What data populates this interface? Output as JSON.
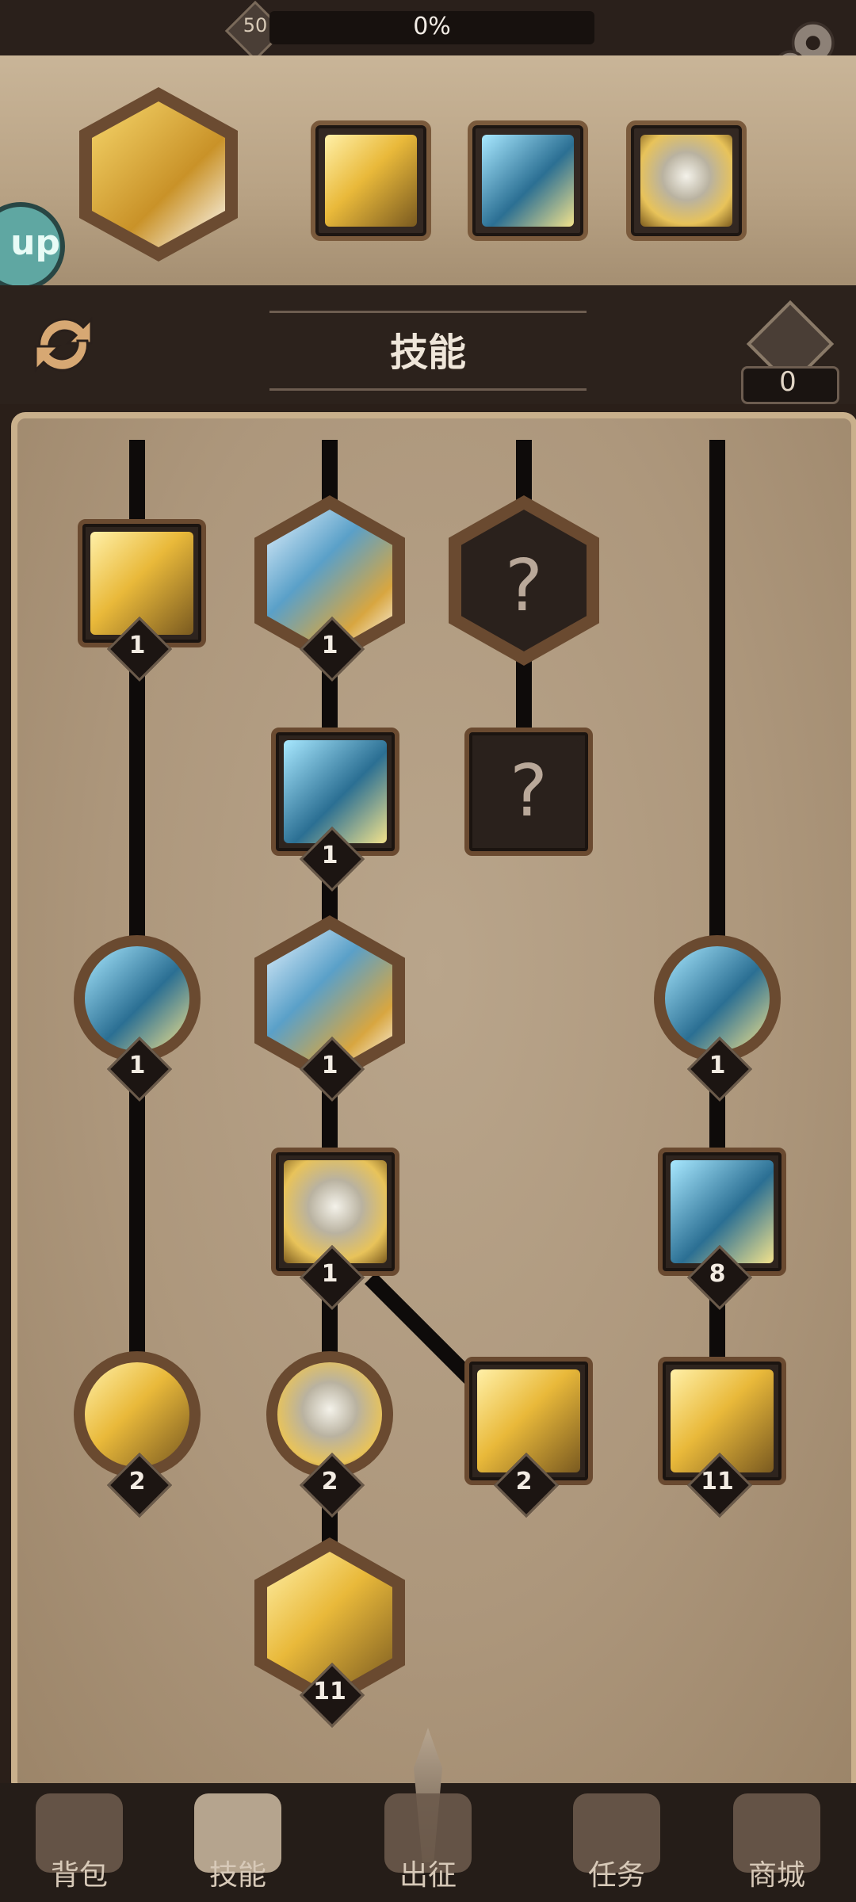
{
  "header": {
    "level": "50",
    "xp_percent_text": "0%",
    "xp_percent": 0
  },
  "equipped_skills": [
    {
      "icon": "lightning-hand-icon",
      "shape": "hex"
    },
    {
      "icon": "lightning-strike-icon",
      "shape": "square"
    },
    {
      "icon": "ice-lightning-icon",
      "shape": "square"
    },
    {
      "icon": "golden-knight-icon",
      "shape": "square"
    }
  ],
  "up_badge": "up",
  "panel": {
    "title": "技能",
    "gem_count": "0"
  },
  "skill_tree": [
    {
      "id": "wind-slash",
      "shape": "square",
      "level": "1",
      "icon": "wind-slash-icon"
    },
    {
      "id": "holy-guardian",
      "shape": "hex",
      "level": "1",
      "icon": "holy-guardian-icon"
    },
    {
      "id": "locked-hex",
      "shape": "hex",
      "level": "",
      "icon": "locked-skill-icon",
      "locked": true
    },
    {
      "id": "blade-storm",
      "shape": "square",
      "level": "1",
      "icon": "blade-storm-icon"
    },
    {
      "id": "locked-square",
      "shape": "square",
      "level": "",
      "icon": "locked-skill-icon",
      "locked": true
    },
    {
      "id": "storm-tome",
      "shape": "circle",
      "level": "1",
      "icon": "storm-tome-icon"
    },
    {
      "id": "holy-shield",
      "shape": "hex",
      "level": "1",
      "icon": "holy-shield-icon"
    },
    {
      "id": "storm-staff",
      "shape": "circle",
      "level": "1",
      "icon": "storm-staff-icon"
    },
    {
      "id": "golden-knight",
      "shape": "square",
      "level": "1",
      "icon": "golden-knight-icon"
    },
    {
      "id": "ice-lightning",
      "shape": "square",
      "level": "8",
      "icon": "ice-lightning-icon"
    },
    {
      "id": "lightning-book",
      "shape": "circle",
      "level": "2",
      "icon": "lightning-book-icon"
    },
    {
      "id": "armored-knight",
      "shape": "circle",
      "level": "2",
      "icon": "armored-knight-icon"
    },
    {
      "id": "golden-clock",
      "shape": "square",
      "level": "2",
      "icon": "golden-clock-icon"
    },
    {
      "id": "lightning-strike",
      "shape": "square",
      "level": "11",
      "icon": "lightning-strike-icon"
    },
    {
      "id": "lightning-hand",
      "shape": "hex",
      "level": "11",
      "icon": "lightning-hand-icon"
    }
  ],
  "nav": [
    {
      "label": "背包",
      "icon": "backpack-icon",
      "active": false
    },
    {
      "label": "技能",
      "icon": "skill-book-icon",
      "active": true
    },
    {
      "label": "出征",
      "icon": "sword-icon",
      "active": false
    },
    {
      "label": "任务",
      "icon": "scroll-icon",
      "active": false
    },
    {
      "label": "商城",
      "icon": "shop-crown-icon",
      "active": false
    }
  ]
}
